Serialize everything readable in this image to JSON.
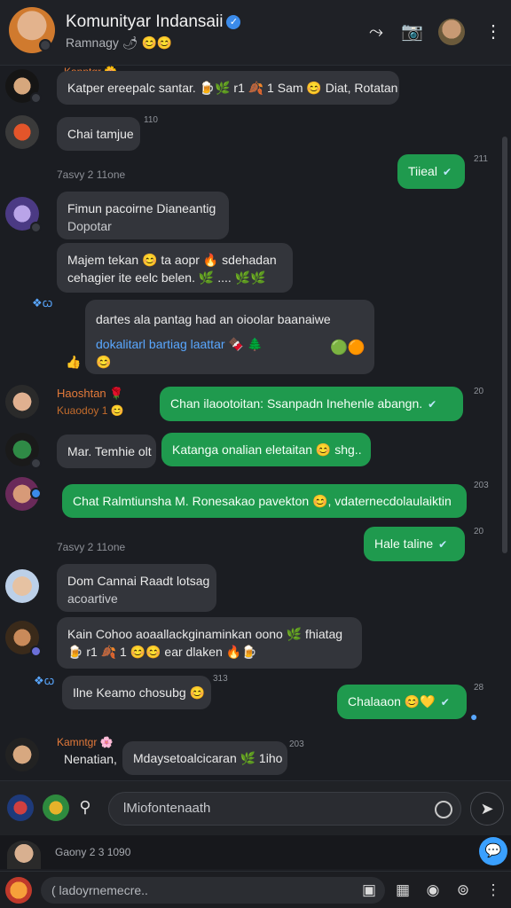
{
  "header": {
    "title": "Komunityar Indansaii",
    "subtitle": "Ramnagy 🌶 😊😊",
    "icons": [
      "share-icon",
      "camera-icon",
      "avatar",
      "more-vert-icon"
    ]
  },
  "chat": {
    "date_separators": [
      "7asvy 2 11one",
      "7asvy 2 11one"
    ],
    "messages": [
      {
        "name": "Kanntgr 🌼",
        "text": "Katper ereepalc santar. 🍺🌿 r1 🍂 1 Sam 😊 Diat, Rotatan",
        "time": ""
      },
      {
        "text": "Chai tamjue",
        "time": "110"
      },
      {
        "text": "Tiieal",
        "time": "211"
      },
      {
        "line1": "Fimun pacoirne Dianeantig",
        "line2": "Dopotar",
        "time": ""
      },
      {
        "line1": "Majem tekan 😊 ta aopr 🔥 sdehadan",
        "line2": "cehagier ite eelc belen. 🌿 .... 🌿🌿",
        "time": ""
      },
      {
        "line1": "dartes ala pantag had an oioolar baanaiwe",
        "line2": "dokalitarl bartiag laattar 🍫 🌲",
        "time": "",
        "left_icon": "🔷"
      },
      {
        "name": "Haoshtan 🌹",
        "sub": "Kuaodoy 1 😊",
        "text": "Chan ilaootoitan: Ssanpadn Inehenle abangn.",
        "time": "20"
      },
      {
        "text": "Mar. Temhie olt",
        "time": ""
      },
      {
        "text": "Katanga onalian eletaitan 😊 shg..",
        "time": ""
      },
      {
        "text": "Chat Ralmtiunsha M. Ronesakao pavekton 😊, vdaternecdolaulaiktin",
        "time": "203"
      },
      {
        "text": "Hale taline",
        "time": "20"
      },
      {
        "line1": "Dom Cannai Raadt lotsag",
        "line2": "acoartive",
        "time": ""
      },
      {
        "line1": "Kain Cohoo aoaallackginaminkan oono 🌿 fhiatag",
        "line2": "🍺 r1 🍂 1 😊😊 ear dlaken 🔥🍺",
        "time": ""
      },
      {
        "text": "Ilne Keamo chosubg 😊",
        "time": "313"
      },
      {
        "text": "Chalaaon 😊💛",
        "time": "28"
      },
      {
        "name": "Kamntgr 🌸",
        "text_left": "Nenatian,",
        "text": "Mdaysetoalcicaran 🌿 1iho",
        "time": "203"
      }
    ]
  },
  "composer": {
    "placeholder": "lMiofontenaath"
  },
  "strip": {
    "text": "Gaony 2 3 1090"
  },
  "bottom": {
    "placeholder": "( ladoyrnemecre.."
  }
}
